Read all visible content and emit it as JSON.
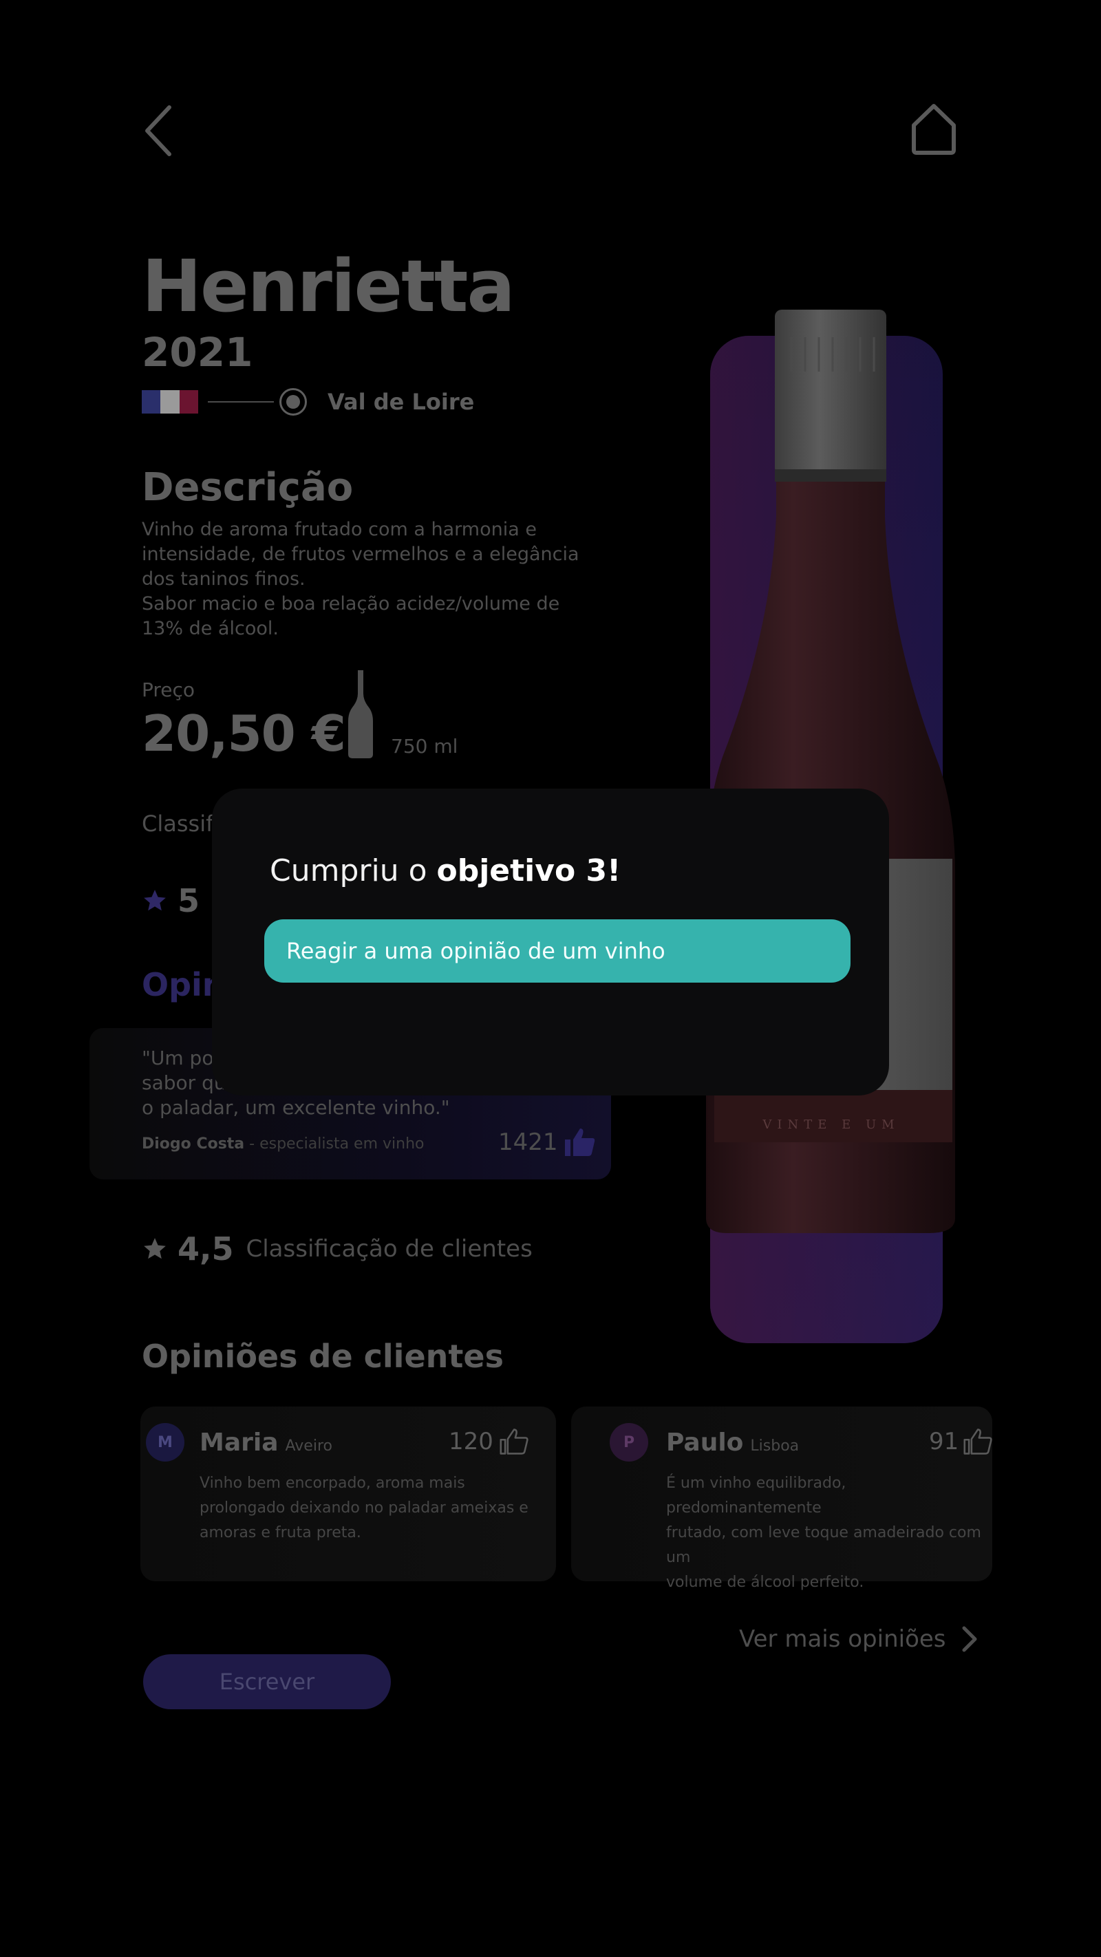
{
  "nav": {
    "back_icon": "chevron-left-icon",
    "home_icon": "home-icon"
  },
  "wine": {
    "name": "Henrietta",
    "year": "2021",
    "region": "Val de Loire",
    "flag_colors": [
      "#2a2f6b",
      "#9a9a9a",
      "#6b1430"
    ]
  },
  "description": {
    "title": "Descrição",
    "text": "Vinho de aroma frutado com a harmonia e intensidade, de frutos vermelhos e a elegância dos taninos finos.\nSabor macio e boa relação acidez/volume de 13% de álcool."
  },
  "price": {
    "label": "Preço",
    "value": "20,50 €",
    "volume": "750 ml"
  },
  "expert": {
    "classification_label": "Classif",
    "rating": "5",
    "opinions_title": "Opin",
    "quote": "\"Um por\nsabor qu\no paladar, um excelente vinho.\"",
    "author_name": "Diogo Costa",
    "author_role": " - especialista em vinho",
    "likes": "1421"
  },
  "clients": {
    "rating": "4,5",
    "rating_label": "Classificação de clientes",
    "title": "Opiniões de clientes",
    "reviews": [
      {
        "initial": "M",
        "name": "Maria",
        "city": "Aveiro",
        "likes": "120",
        "text": "Vinho bem encorpado, aroma mais\nprolongado deixando no paladar ameixas e\namoras e fruta preta."
      },
      {
        "initial": "P",
        "name": "Paulo",
        "city": "Lisboa",
        "likes": "91",
        "text": "É um vinho equilibrado, predominantemente\nfrutado, com leve toque amadeirado com um\nvolume de álcool perfeito."
      }
    ],
    "more_link": "Ver mais opiniões",
    "write_button": "Escrever"
  },
  "bottle_label": {
    "script": "",
    "band_text": "VINTE E UM"
  },
  "modal": {
    "title_prefix": "Cumpriu o ",
    "title_bold": "objetivo 3!",
    "goal_text": "Reagir a uma opinião de um vinho"
  },
  "colors": {
    "accent_teal": "#36b3ad",
    "accent_purple": "#1f1a48",
    "background": "#000000"
  }
}
